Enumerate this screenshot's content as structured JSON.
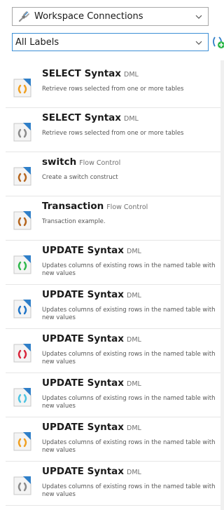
{
  "connections": {
    "label": "Workspace Connections"
  },
  "labels_filter": {
    "label": "All Labels"
  },
  "snippets": [
    {
      "title": "SELECT Syntax",
      "category": "DML",
      "description": "Retrieve rows selected from one or more tables",
      "accent": "#f0a020"
    },
    {
      "title": "SELECT Syntax",
      "category": "DML",
      "description": "Retrieve rows selected from one or more tables",
      "accent": "#8a8a8a"
    },
    {
      "title": "switch",
      "category": "Flow Control",
      "description": "Create a switch construct",
      "accent": "#b5651d"
    },
    {
      "title": "Transaction",
      "category": "Flow Control",
      "description": "Transaction example.",
      "accent": "#b5651d"
    },
    {
      "title": "UPDATE Syntax",
      "category": "DML",
      "description": "Updates columns of existing rows in the named table with new values",
      "accent": "#2db84a"
    },
    {
      "title": "UPDATE Syntax",
      "category": "DML",
      "description": "Updates columns of existing rows in the named table with new values",
      "accent": "#1e74c8"
    },
    {
      "title": "UPDATE Syntax",
      "category": "DML",
      "description": "Updates columns of existing rows in the named table with new values",
      "accent": "#d9243a"
    },
    {
      "title": "UPDATE Syntax",
      "category": "DML",
      "description": "Updates columns of existing rows in the named table with new values",
      "accent": "#4cc3e0"
    },
    {
      "title": "UPDATE Syntax",
      "category": "DML",
      "description": "Updates columns of existing rows in the named table with new values",
      "accent": "#f0a020"
    },
    {
      "title": "UPDATE Syntax",
      "category": "DML",
      "description": "Updates columns of existing rows in the named table with new values",
      "accent": "#8a8a8a"
    }
  ],
  "icons": {
    "connection": "plug-icon",
    "dropdown": "chevron-down-icon",
    "add_label": "add-label-icon",
    "snippet": "code-document-icon"
  },
  "colors": {
    "focus_border": "#3c8fd6",
    "doc_fold": "#2f7fc8"
  }
}
